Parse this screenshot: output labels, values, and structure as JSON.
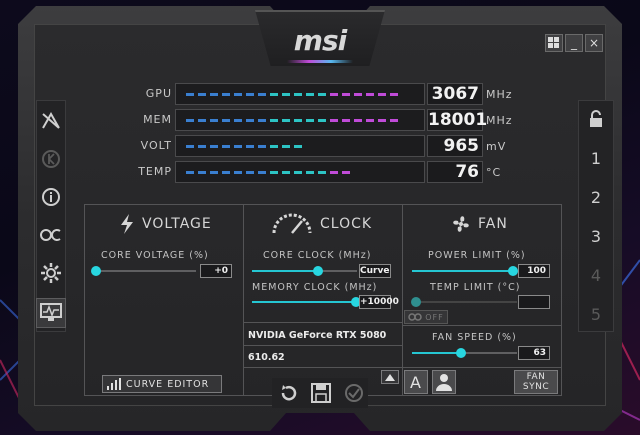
{
  "brand": "msi",
  "window_controls": {
    "winkey_icon": "windows-icon",
    "minimize": "_",
    "close": "×"
  },
  "sidebar_left": [
    "kombustor-icon",
    "k-circle-icon",
    "info-icon",
    "oc-scanner-icon",
    "settings-gear-icon",
    "monitor-icon"
  ],
  "sidebar_right": {
    "lock_icon": "lock-icon",
    "profiles": [
      "1",
      "2",
      "3",
      "4",
      "5"
    ]
  },
  "monitor": [
    {
      "label": "GPU",
      "value": "3067",
      "unit": "MHz",
      "fill": 0.89
    },
    {
      "label": "MEM",
      "value": "18001",
      "unit": "MHz",
      "fill": 0.92
    },
    {
      "label": "VOLT",
      "value": "965",
      "unit": "mV",
      "fill": 0.47
    },
    {
      "label": "TEMP",
      "value": "76",
      "unit": "°C",
      "fill": 0.72
    }
  ],
  "voltage": {
    "title": "VOLTAGE",
    "core_voltage_label": "CORE VOLTAGE  (%)",
    "core_voltage_value": "+0",
    "curve_editor_label": "CURVE EDITOR"
  },
  "clock": {
    "title": "CLOCK",
    "core_clock_label": "CORE CLOCK (MHz)",
    "core_clock_value": "Curve",
    "memory_clock_label": "MEMORY CLOCK (MHz)",
    "memory_clock_value": "+10000",
    "gpu_name": "NVIDIA GeForce RTX 5080",
    "driver_version": "610.62"
  },
  "fan": {
    "title": "FAN",
    "power_limit_label": "POWER LIMIT (%)",
    "power_limit_value": "100",
    "temp_limit_label": "TEMP LIMIT (°C)",
    "temp_limit_value": "",
    "link_toggle_label": "OFF",
    "fan_speed_label": "FAN SPEED (%)",
    "fan_speed_value": "63",
    "auto_label": "A",
    "fan_sync_label_1": "FAN",
    "fan_sync_label_2": "SYNC"
  },
  "bottom_controls": [
    "reset-icon",
    "save-icon",
    "apply-check-icon"
  ],
  "colors": {
    "accent_cyan": "#28d6e0",
    "bar_purple": "#c04bd8",
    "bar_teal": "#2dc4c4",
    "bar_blue": "#3a7fd0"
  }
}
